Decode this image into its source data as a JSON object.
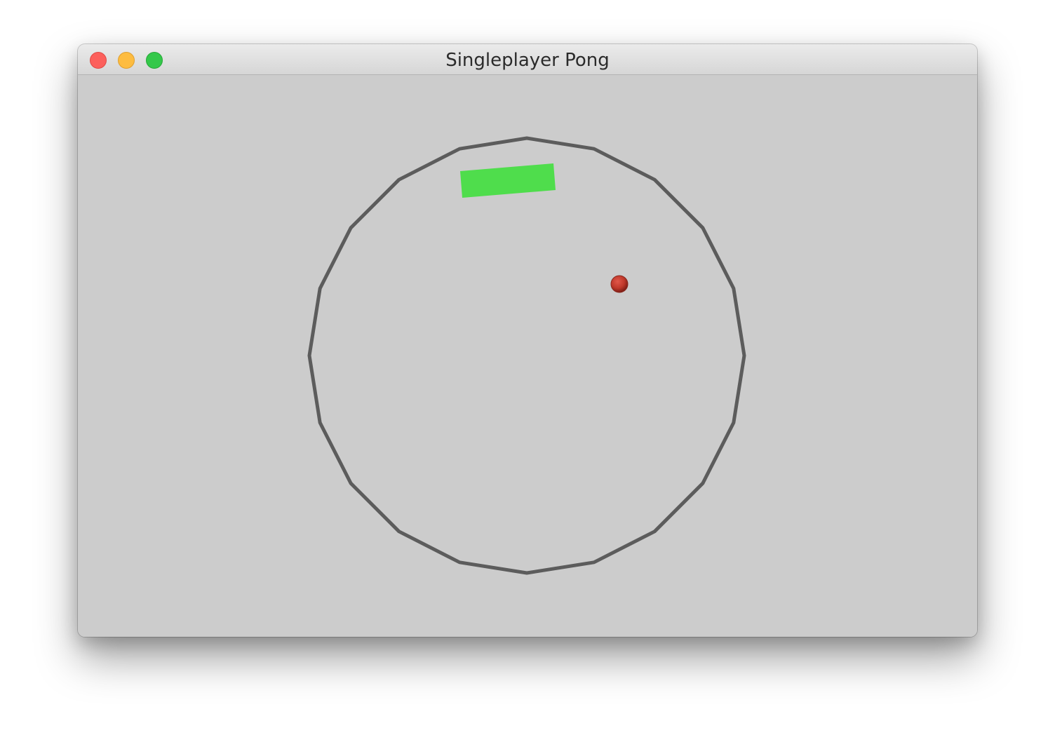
{
  "window": {
    "title": "Singleplayer Pong",
    "buttons": {
      "close": "close",
      "minimize": "minimize",
      "zoom": "zoom"
    }
  },
  "game": {
    "arena_shape": "polygon-circle",
    "arena_color": "#5c5c5c",
    "background_color": "#cccccc",
    "paddle_color": "#4fdd4c",
    "ball_color": "#c0392b"
  }
}
